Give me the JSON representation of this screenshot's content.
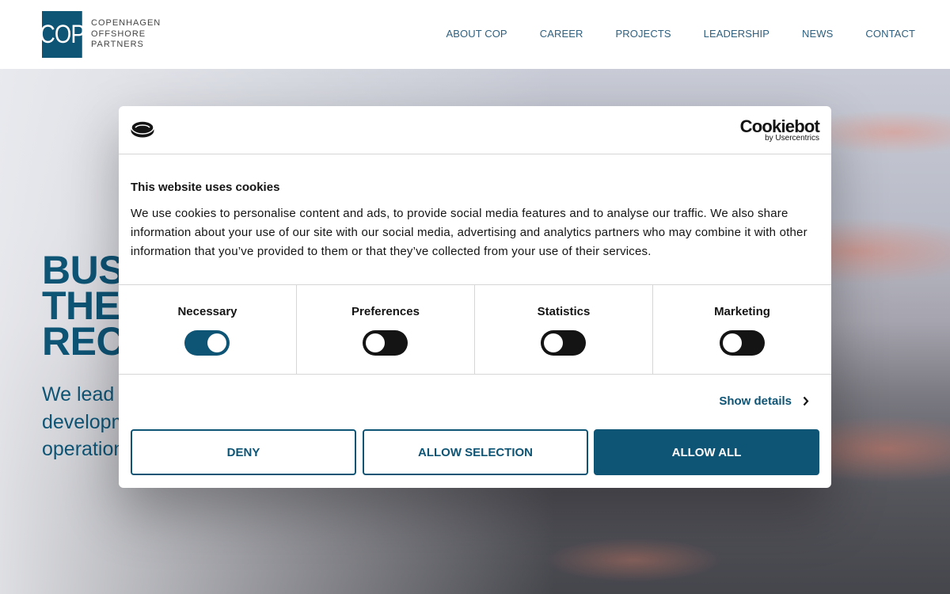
{
  "logo": {
    "mark": "COP",
    "line1": "COPENHAGEN",
    "line2": "OFFSHORE",
    "line3": "PARTNERS"
  },
  "nav": [
    "ABOUT COP",
    "CAREER",
    "PROJECTS",
    "LEADERSHIP",
    "NEWS",
    "CONTACT"
  ],
  "hero": {
    "title_lines": [
      "BUS",
      "THE",
      "RECO"
    ],
    "subtitle_lines": [
      "We lead c",
      "developm",
      "operation"
    ]
  },
  "dialog": {
    "brand": "Cookiebot",
    "brand_sub": "by Usercentrics",
    "title": "This website uses cookies",
    "text": "We use cookies to personalise content and ads, to provide social media features and to analyse our traffic. We also share information about your use of our site with our social media, advertising and analytics partners who may combine it with other information that you’ve provided to them or that they’ve collected from your use of their services.",
    "toggles": [
      {
        "label": "Necessary",
        "on": true
      },
      {
        "label": "Preferences",
        "on": false
      },
      {
        "label": "Statistics",
        "on": false
      },
      {
        "label": "Marketing",
        "on": false
      }
    ],
    "show_details": "Show details",
    "buttons": {
      "deny": "DENY",
      "allow_selection": "ALLOW SELECTION",
      "allow_all": "ALLOW ALL"
    }
  },
  "colors": {
    "brand": "#0e5475",
    "text": "#141414",
    "toggle_off": "#141414"
  },
  "icons": {
    "cookie": "cookie-icon",
    "chevron": "chevron-right-icon"
  }
}
